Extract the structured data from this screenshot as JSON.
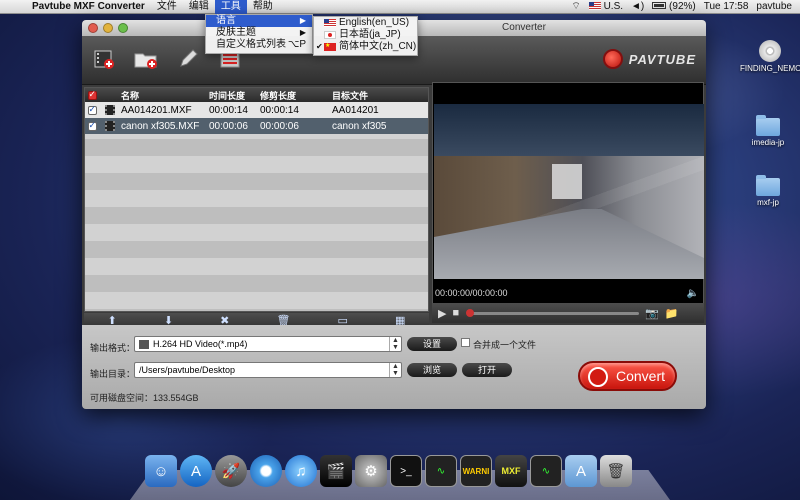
{
  "menubar": {
    "app_name": "Pavtube MXF Converter",
    "menus": [
      "文件",
      "编辑",
      "工具",
      "帮助"
    ],
    "active_menu": "工具",
    "input_source": "U.S.",
    "battery": "(92%)",
    "clock": "Tue 17:58",
    "user": "pavtube"
  },
  "tools_menu": {
    "items": [
      {
        "label": "语言",
        "submenu": true
      },
      {
        "label": "皮肤主题",
        "submenu": true
      },
      {
        "label": "自定义格式列表",
        "shortcut": "⌥P"
      }
    ]
  },
  "language_submenu": {
    "items": [
      {
        "label": "English(en_US)",
        "flag": "us"
      },
      {
        "label": "日本語(ja_JP)",
        "flag": "jp"
      },
      {
        "label": "简体中文(zh_CN)",
        "flag": "cn",
        "checked": true
      }
    ]
  },
  "window": {
    "title": "Pavtube MXF Converter",
    "title_visible_fragment": "Converter",
    "logo": "PAVTUBE"
  },
  "table": {
    "headers": {
      "name": "名称",
      "duration": "时间长度",
      "trim": "修剪长度",
      "target": "目标文件"
    },
    "rows": [
      {
        "name": "AA014201.MXF",
        "duration": "00:00:14",
        "trim": "00:00:14",
        "target": "AA014201",
        "checked": true,
        "selected": false
      },
      {
        "name": "canon xf305.MXF",
        "duration": "00:00:06",
        "trim": "00:00:06",
        "target": "canon xf305",
        "checked": true,
        "selected": true
      }
    ]
  },
  "preview": {
    "time": "00:00:00/00:00:00"
  },
  "output": {
    "format_label": "输出格式：",
    "format_value": "H.264 HD Video(*.mp4)",
    "settings_button": "设置",
    "merge_label": "合并成一个文件",
    "dir_label": "输出目录：",
    "dir_value": "/Users/pavtube/Desktop",
    "browse_button": "浏览",
    "open_button": "打开",
    "disk_space": "可用磁盘空间：133.554GB",
    "convert_button": "Convert"
  },
  "desktop_icons": [
    {
      "label": "FINDING_NEMO",
      "kind": "cd"
    },
    {
      "label": "imedia-jp",
      "kind": "folder"
    },
    {
      "label": "mxf-jp",
      "kind": "folder"
    }
  ],
  "dock_items": [
    "finder-icon",
    "app-store-icon",
    "launchpad-icon",
    "safari-icon",
    "itunes-icon",
    "final-cut-icon",
    "system-preferences-icon",
    "terminal-icon",
    "activity-monitor-icon",
    "console-icon",
    "mxf-converter-icon",
    "activity-monitor-icon",
    "applications-folder-icon",
    "trash-icon"
  ],
  "dock_labels": {
    "console": "WARNI",
    "mxf": "MXF"
  }
}
